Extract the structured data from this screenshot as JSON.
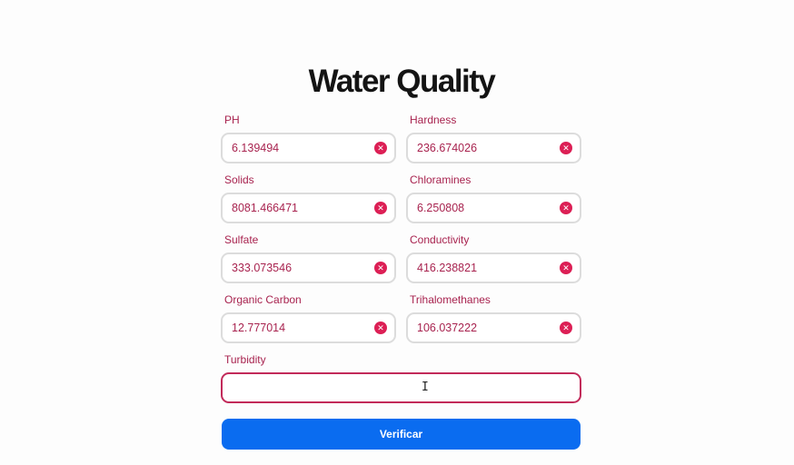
{
  "page": {
    "title": "Water Quality"
  },
  "fields": [
    {
      "label": "PH",
      "value": "6.139494"
    },
    {
      "label": "Hardness",
      "value": "236.674026"
    },
    {
      "label": "Solids",
      "value": "8081.466471"
    },
    {
      "label": "Chloramines",
      "value": "6.250808"
    },
    {
      "label": "Sulfate",
      "value": "333.073546"
    },
    {
      "label": "Conductivity",
      "value": "416.238821"
    },
    {
      "label": "Organic Carbon",
      "value": "12.777014"
    },
    {
      "label": "Trihalomethanes",
      "value": "106.037222"
    }
  ],
  "turbidity": {
    "label": "Turbidity",
    "value": ""
  },
  "actions": {
    "verify_label": "Verificar"
  },
  "icons": {
    "clear": "x-circle-icon",
    "cursor": "text-cursor-icon"
  },
  "colors": {
    "label": "#a8234f",
    "clear_icon": "#dc1f55",
    "active_border": "#c22a5a",
    "button": "#0a6cf0"
  }
}
